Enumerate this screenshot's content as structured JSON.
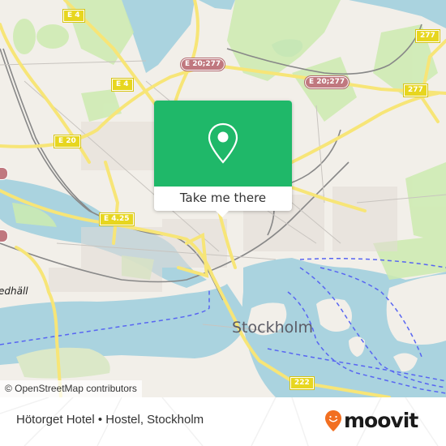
{
  "map": {
    "city_label": "Stockholm",
    "district_label_partial": "edhäll",
    "attribution": "© OpenStreetMap contributors",
    "colors": {
      "land": "#f2efe9",
      "water": "#aad3df",
      "park": "#cdebb0",
      "road_major": "#f7e577",
      "ferry_route": "#5865f2"
    },
    "road_shields": [
      {
        "label": "E 4",
        "style": "yellow"
      },
      {
        "label": "E 4",
        "style": "yellow"
      },
      {
        "label": "E 20",
        "style": "yellow"
      },
      {
        "label": "E 4.25",
        "style": "yellow"
      },
      {
        "label": "E 20;277",
        "style": "red"
      },
      {
        "label": "E 20;277",
        "style": "red"
      },
      {
        "label": "277",
        "style": "yellow"
      },
      {
        "label": "277",
        "style": "yellow"
      },
      {
        "label": "222",
        "style": "yellow"
      }
    ]
  },
  "popup": {
    "icon": "map-pin-icon",
    "accent_color": "#1fb869",
    "button_label": "Take me there"
  },
  "footer": {
    "title": "Hötorget Hotel • Hostel, Stockholm",
    "brand": "moovit",
    "brand_icon": "moovit-logo-icon",
    "brand_color": "#f26f21"
  }
}
